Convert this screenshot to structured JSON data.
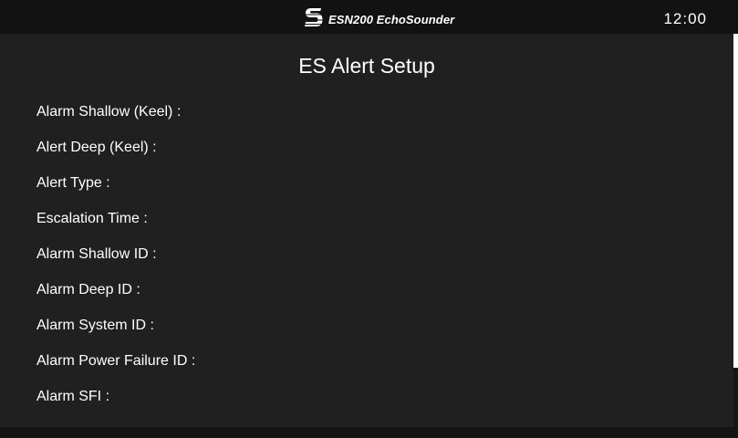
{
  "header": {
    "app_name": "ESN200 EchoSounder",
    "logo_icon": "s-logo-icon",
    "clock": "12:00"
  },
  "page": {
    "title": "ES Alert Setup"
  },
  "fields": [
    {
      "label": "Alarm Shallow (Keel) :"
    },
    {
      "label": "Alert Deep (Keel) :"
    },
    {
      "label": "Alert Type :"
    },
    {
      "label": "Escalation Time :"
    },
    {
      "label": "Alarm Shallow ID :"
    },
    {
      "label": "Alarm Deep ID :"
    },
    {
      "label": "Alarm System ID :"
    },
    {
      "label": "Alarm Power Failure ID :"
    },
    {
      "label": "Alarm SFI :"
    }
  ],
  "colors": {
    "background": "#202021",
    "header": "#121213",
    "text": "#ffffff"
  }
}
